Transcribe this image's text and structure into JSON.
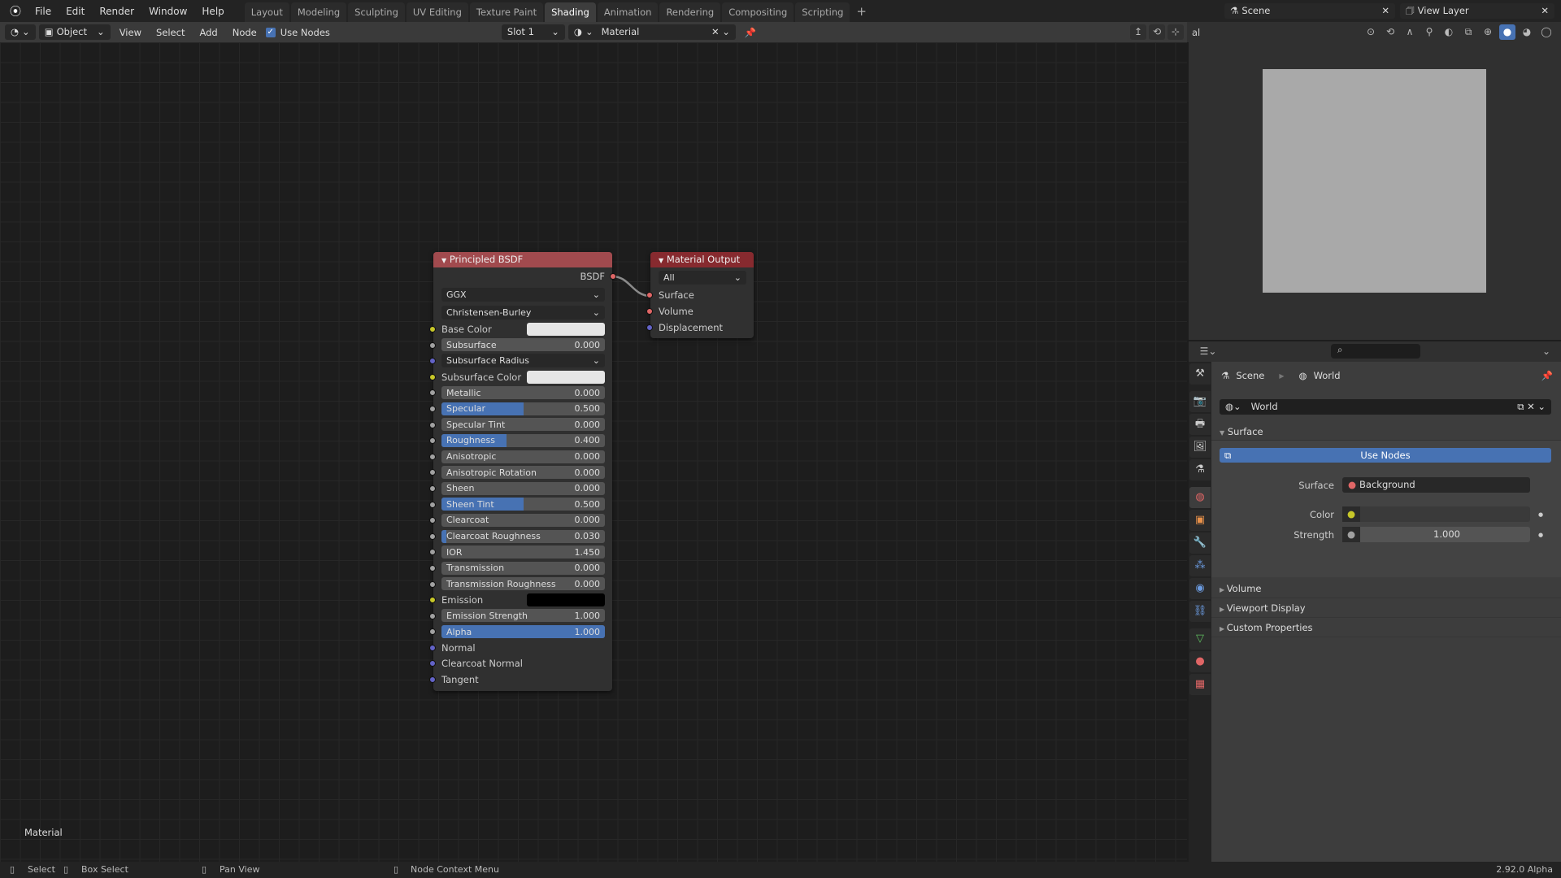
{
  "menu": [
    "File",
    "Edit",
    "Render",
    "Window",
    "Help"
  ],
  "workspaces": [
    "Layout",
    "Modeling",
    "Sculpting",
    "UV Editing",
    "Texture Paint",
    "Shading",
    "Animation",
    "Rendering",
    "Compositing",
    "Scripting"
  ],
  "active_workspace": "Shading",
  "scene": {
    "label": "Scene",
    "view_layer": "View Layer"
  },
  "header": {
    "mode": "Object",
    "view": "View",
    "select": "Select",
    "add": "Add",
    "node": "Node",
    "use_nodes": "Use Nodes",
    "use_nodes_checked": true,
    "slot": "Slot 1",
    "material": "Material",
    "shading_partial": "al"
  },
  "principled": {
    "title": "Principled BSDF",
    "output": "BSDF",
    "distribution": "GGX",
    "subsurface_method": "Christensen-Burley",
    "inputs": [
      {
        "label": "Base Color",
        "type": "color",
        "swatch": "#e6e6e6",
        "socket": "#c7c729"
      },
      {
        "label": "Subsurface",
        "type": "float",
        "value": "0.000",
        "fill": 0,
        "socket": "#a1a1a1"
      },
      {
        "label": "Subsurface Radius",
        "type": "vector",
        "socket": "#6363c7"
      },
      {
        "label": "Subsurface Color",
        "type": "color",
        "swatch": "#e6e6e6",
        "socket": "#c7c729"
      },
      {
        "label": "Metallic",
        "type": "float",
        "value": "0.000",
        "fill": 0,
        "socket": "#a1a1a1"
      },
      {
        "label": "Specular",
        "type": "float",
        "value": "0.500",
        "fill": 0.5,
        "socket": "#a1a1a1"
      },
      {
        "label": "Specular Tint",
        "type": "float",
        "value": "0.000",
        "fill": 0,
        "socket": "#a1a1a1"
      },
      {
        "label": "Roughness",
        "type": "float",
        "value": "0.400",
        "fill": 0.4,
        "socket": "#a1a1a1"
      },
      {
        "label": "Anisotropic",
        "type": "float",
        "value": "0.000",
        "fill": 0,
        "socket": "#a1a1a1"
      },
      {
        "label": "Anisotropic Rotation",
        "type": "float",
        "value": "0.000",
        "fill": 0,
        "socket": "#a1a1a1"
      },
      {
        "label": "Sheen",
        "type": "float",
        "value": "0.000",
        "fill": 0,
        "socket": "#a1a1a1"
      },
      {
        "label": "Sheen Tint",
        "type": "float",
        "value": "0.500",
        "fill": 0.5,
        "socket": "#a1a1a1"
      },
      {
        "label": "Clearcoat",
        "type": "float",
        "value": "0.000",
        "fill": 0,
        "socket": "#a1a1a1"
      },
      {
        "label": "Clearcoat Roughness",
        "type": "float",
        "value": "0.030",
        "fill": 0.03,
        "socket": "#a1a1a1"
      },
      {
        "label": "IOR",
        "type": "float",
        "value": "1.450",
        "fill": 0,
        "socket": "#a1a1a1"
      },
      {
        "label": "Transmission",
        "type": "float",
        "value": "0.000",
        "fill": 0,
        "socket": "#a1a1a1"
      },
      {
        "label": "Transmission Roughness",
        "type": "float",
        "value": "0.000",
        "fill": 0,
        "socket": "#a1a1a1"
      },
      {
        "label": "Emission",
        "type": "color",
        "swatch": "#000000",
        "socket": "#c7c729"
      },
      {
        "label": "Emission Strength",
        "type": "float",
        "value": "1.000",
        "fill": 0,
        "socket": "#a1a1a1"
      },
      {
        "label": "Alpha",
        "type": "float",
        "value": "1.000",
        "fill": 1,
        "socket": "#a1a1a1"
      },
      {
        "label": "Normal",
        "type": "socket",
        "socket": "#6363c7"
      },
      {
        "label": "Clearcoat Normal",
        "type": "socket",
        "socket": "#6363c7"
      },
      {
        "label": "Tangent",
        "type": "socket",
        "socket": "#6363c7"
      }
    ]
  },
  "output_node": {
    "title": "Material Output",
    "target": "All",
    "inputs": [
      {
        "label": "Surface",
        "socket": "#e06666"
      },
      {
        "label": "Volume",
        "socket": "#e06666"
      },
      {
        "label": "Displacement",
        "socket": "#6363c7"
      }
    ]
  },
  "editor_label": "Material",
  "properties": {
    "breadcrumb": [
      "Scene",
      "World"
    ],
    "world": "World",
    "surface_panel": "Surface",
    "use_nodes": "Use Nodes",
    "surface_label": "Surface",
    "surface_value": "Background",
    "color_label": "Color",
    "strength_label": "Strength",
    "strength_value": "1.000",
    "collapsed": [
      "Volume",
      "Viewport Display",
      "Custom Properties"
    ],
    "tabs": [
      {
        "icon": "tool-icon",
        "glyph": "⚒",
        "color": "#ccc"
      },
      {
        "icon": "render-icon",
        "glyph": "📷",
        "color": "#ccc"
      },
      {
        "icon": "output-icon",
        "glyph": "🖶",
        "color": "#ccc"
      },
      {
        "icon": "view-layer-icon",
        "glyph": "🖼",
        "color": "#ccc"
      },
      {
        "icon": "scene-icon",
        "glyph": "⚗",
        "color": "#ccc"
      },
      {
        "icon": "world-icon",
        "glyph": "◍",
        "color": "#e06666",
        "active": true
      },
      {
        "icon": "object-icon",
        "glyph": "▣",
        "color": "#e8914a"
      },
      {
        "icon": "modifier-icon",
        "glyph": "🔧",
        "color": "#6b9be0"
      },
      {
        "icon": "particles-icon",
        "glyph": "⁂",
        "color": "#6b9be0"
      },
      {
        "icon": "physics-icon",
        "glyph": "◉",
        "color": "#6b9be0"
      },
      {
        "icon": "constraints-icon",
        "glyph": "⛓",
        "color": "#6b9be0"
      },
      {
        "icon": "data-icon",
        "glyph": "▽",
        "color": "#5fbf5f"
      },
      {
        "icon": "material-icon",
        "glyph": "●",
        "color": "#e06666"
      },
      {
        "icon": "texture-icon",
        "glyph": "▦",
        "color": "#e06666"
      }
    ]
  },
  "status": {
    "select": "Select",
    "box_select": "Box Select",
    "pan_view": "Pan View",
    "context_menu": "Node Context Menu",
    "version": "2.92.0 Alpha"
  },
  "colors": {
    "accent": "#4772b3",
    "node_header_shader": "#a14a4e",
    "node_header_output": "#872a2f"
  }
}
